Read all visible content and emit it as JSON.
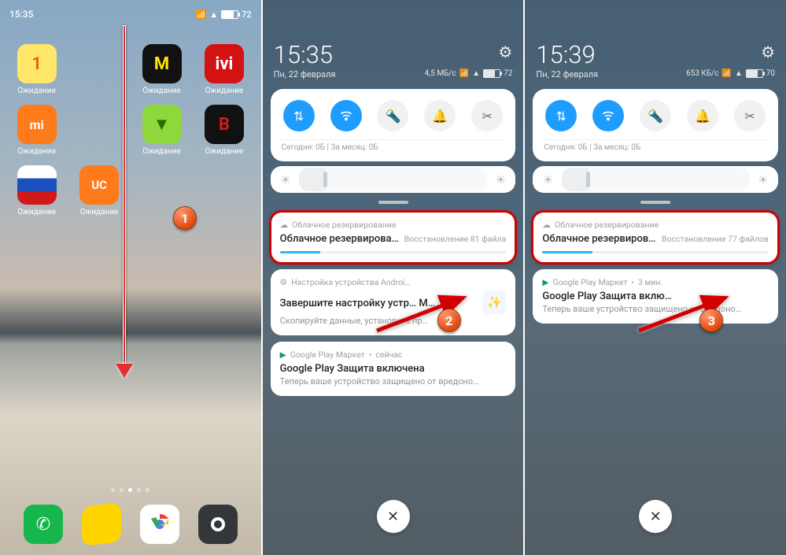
{
  "screens": {
    "home": {
      "statusbar": {
        "time": "15:35",
        "battery": "72"
      },
      "app_label": "Ожидание",
      "apps_row1": [
        {
          "bg": "#ffe76a",
          "glyph": "1",
          "fg": "#e36b00"
        },
        {
          "bg": "#111",
          "glyph": "M",
          "fg": "#ffe600"
        },
        {
          "bg": "#d31212",
          "glyph": "ivi",
          "fg": "#fff"
        }
      ],
      "apps_row2": [
        {
          "bg": "#ff7a1a",
          "glyph": "mi",
          "fg": "#fff"
        },
        {
          "bg": "#8fd83b",
          "glyph": "▾",
          "fg": "#2e6b00"
        },
        {
          "bg": "#111",
          "glyph": "B",
          "fg": "#d21c1c"
        }
      ],
      "apps_row3": [
        {
          "bg": "linear-gradient(#fff 33%,#1a4fbf 33% 66%,#d01919 66%)",
          "glyph": "",
          "fg": "#fff"
        },
        {
          "bg": "#ff7a1a",
          "glyph": "UC",
          "fg": "#fff"
        }
      ],
      "dock": [
        {
          "bg": "#17b64c",
          "svg": "phone"
        },
        {
          "bg": "#ffd500",
          "svg": "note"
        },
        {
          "bg": "#fff",
          "svg": "chrome"
        },
        {
          "bg": "#33373a",
          "svg": "camera"
        }
      ]
    },
    "shade2": {
      "time": "15:35",
      "date": "Пн, 22 февраля",
      "net_speed": "4,5 МБ/с",
      "battery": "72",
      "usage": "Сегодня: 0Б   |   За месяц: 0Б",
      "cloud": {
        "app": "Облачное резервирование",
        "title": "Облачное резервирова…",
        "status": "Восстановление 81 файла"
      },
      "setup": {
        "app": "Настройка устройства Androi…",
        "title": "Завершите настройку устр…     М…",
        "body": "Скопируйте данные, установите пр…"
      },
      "play": {
        "app": "Google Play Маркет",
        "time_ago": "сейчас",
        "title": "Google Play Защита включена",
        "body": "Теперь ваше устройство защищено от вредоно…"
      }
    },
    "shade3": {
      "time": "15:39",
      "date": "Пн, 22 февраля",
      "net_speed": "653 КБ/с",
      "battery": "70",
      "usage": "Сегодня: 0Б   |   За месяц: 0Б",
      "cloud": {
        "app": "Облачное резервирование",
        "title": "Облачное резервиров…",
        "status": "Восстановление 77 файлов"
      },
      "play": {
        "app": "Google Play Маркет",
        "time_ago": "3 мин.",
        "title": "Google Play Защита вклю…",
        "body": "Теперь ваше устройство защищено от вредоно…"
      }
    }
  },
  "badges": {
    "b1": "1",
    "b2": "2",
    "b3": "3"
  }
}
